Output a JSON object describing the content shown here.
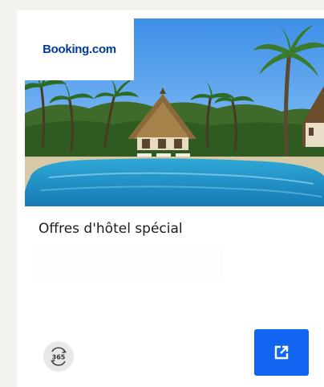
{
  "card": {
    "brand": "Booking.com",
    "title": "Offres d'hôtel spécial",
    "calendar_badge": "365",
    "icons": {
      "calendar": "calendar-365-icon",
      "open": "external-link-icon"
    },
    "colors": {
      "brand": "#003b95",
      "button": "#1265f0"
    }
  }
}
